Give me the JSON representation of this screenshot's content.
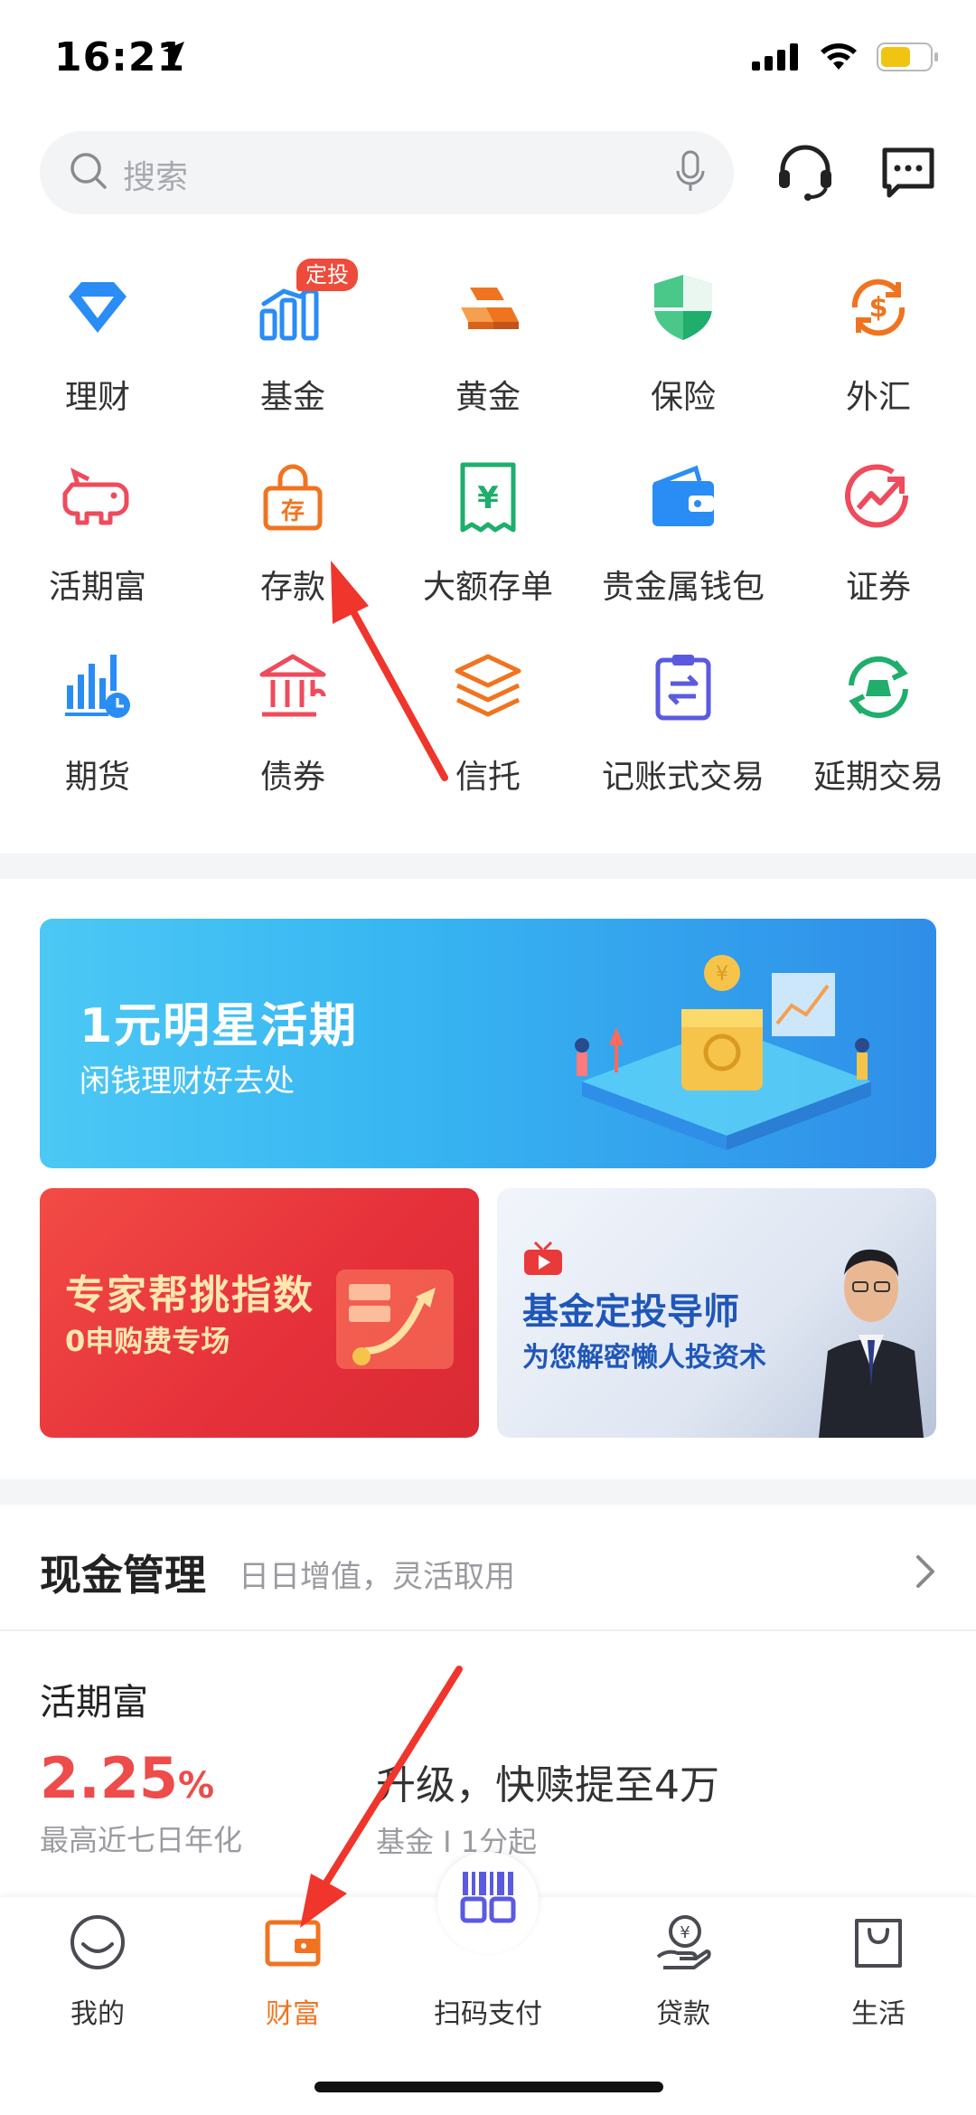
{
  "status_bar": {
    "time": "16:21"
  },
  "search": {
    "placeholder": "搜索"
  },
  "grid": [
    {
      "label": "理财",
      "icon": "diamond-icon",
      "color": "#2a8cf5"
    },
    {
      "label": "基金",
      "icon": "bar-chart-icon",
      "color": "#2a8cf5",
      "badge": "定投"
    },
    {
      "label": "黄金",
      "icon": "gold-bars-icon",
      "color": "#f07420"
    },
    {
      "label": "保险",
      "icon": "shield-icon",
      "color": "#1fae6b"
    },
    {
      "label": "外汇",
      "icon": "currency-exchange-icon",
      "color": "#f07420"
    },
    {
      "label": "活期富",
      "icon": "piggy-bank-icon",
      "color": "#ee4b5c"
    },
    {
      "label": "存款",
      "icon": "lock-deposit-icon",
      "color": "#f07420",
      "icon_text": "存"
    },
    {
      "label": "大额存单",
      "icon": "receipt-icon",
      "color": "#1fae6b",
      "icon_text": "¥"
    },
    {
      "label": "贵金属钱包",
      "icon": "wallet-icon",
      "color": "#2a8cf5"
    },
    {
      "label": "证券",
      "icon": "stock-trend-icon",
      "color": "#ee4b5c"
    },
    {
      "label": "期货",
      "icon": "futures-chart-icon",
      "color": "#2a8cf5"
    },
    {
      "label": "债券",
      "icon": "bank-building-icon",
      "color": "#ee4b5c"
    },
    {
      "label": "信托",
      "icon": "layers-icon",
      "color": "#f07420"
    },
    {
      "label": "记账式交易",
      "icon": "clipboard-exchange-icon",
      "color": "#5a5ae0"
    },
    {
      "label": "延期交易",
      "icon": "cycle-icon",
      "color": "#1fae6b"
    }
  ],
  "banners": {
    "main": {
      "title": "1元明星活期",
      "subtitle": "闲钱理财好去处"
    },
    "left": {
      "title": "专家帮挑指数",
      "subtitle": "0申购费专场"
    },
    "right": {
      "title": "基金定投导师",
      "subtitle": "为您解密懒人投资术"
    }
  },
  "cash_management": {
    "title": "现金管理",
    "subtitle": "日日增值，灵活取用",
    "product": {
      "name": "活期富",
      "rate": "2.25",
      "rate_unit": "%",
      "rate_label": "最高近七日年化",
      "description": "升级，快赎提至4万",
      "meta": "基金 I 1分起"
    }
  },
  "tabbar": [
    {
      "label": "我的",
      "icon": "smile-face-icon",
      "active": false
    },
    {
      "label": "财富",
      "icon": "wallet-icon",
      "active": true
    },
    {
      "label": "扫码支付",
      "icon": "scan-code-icon",
      "active": false
    },
    {
      "label": "贷款",
      "icon": "loan-hand-icon",
      "active": false
    },
    {
      "label": "生活",
      "icon": "shopping-bag-icon",
      "active": false
    }
  ],
  "colors": {
    "accent_orange": "#f07420",
    "rate_red": "#ee4b4b",
    "annotation_red": "#f0352c"
  }
}
